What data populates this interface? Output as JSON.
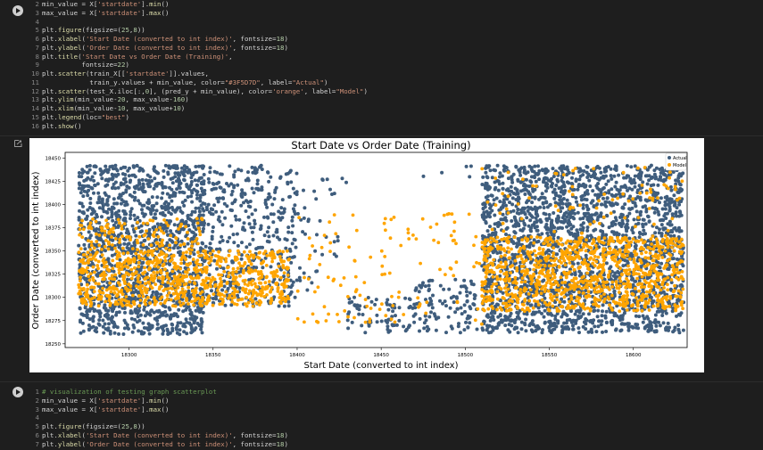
{
  "cell1": {
    "lines": [
      {
        "n": "2",
        "html": "min_value = X[<span class='str'>'startdate'</span>].<span class='fn'>min</span>()"
      },
      {
        "n": "3",
        "html": "max_value = X[<span class='str'>'startdate'</span>].<span class='fn'>max</span>()"
      },
      {
        "n": "4",
        "html": ""
      },
      {
        "n": "5",
        "html": "plt.<span class='fn'>figure</span>(figsize=(<span class='num'>25</span>,<span class='num'>8</span>))"
      },
      {
        "n": "6",
        "html": "plt.<span class='fn'>xlabel</span>(<span class='str'>'Start Date (converted to int index)'</span>, fontsize=<span class='num'>18</span>)"
      },
      {
        "n": "7",
        "html": "plt.<span class='fn'>ylabel</span>(<span class='str'>'Order Date (converted to int index)'</span>, fontsize=<span class='num'>18</span>)"
      },
      {
        "n": "8",
        "html": "plt.<span class='fn'>title</span>(<span class='str'>'Start Date vs Order Date (Training)'</span>,"
      },
      {
        "n": "9",
        "html": "          fontsize=<span class='num'>22</span>)"
      },
      {
        "n": "10",
        "html": "plt.<span class='fn'>scatter</span>(train_X[[<span class='str'>'startdate'</span>]].values,"
      },
      {
        "n": "11",
        "html": "            train_y.values + min_value, color=<span class='str'>\"#3F5D7D\"</span>, label=<span class='str'>\"Actual\"</span>)"
      },
      {
        "n": "12",
        "html": "plt.<span class='fn'>scatter</span>(test_X.iloc[:,<span class='num'>0</span>], (pred_y + min_value), color=<span class='str'>'orange'</span>, label=<span class='str'>\"Model\"</span>)"
      },
      {
        "n": "13",
        "html": "plt.<span class='fn'>ylim</span>(min_value-<span class='num'>20</span>, max_value-<span class='num'>160</span>)"
      },
      {
        "n": "14",
        "html": "plt.<span class='fn'>xlim</span>(min_value-<span class='num'>10</span>, max_value+<span class='num'>10</span>)"
      },
      {
        "n": "15",
        "html": "plt.<span class='fn'>legend</span>(loc=<span class='str'>\"best\"</span>)"
      },
      {
        "n": "16",
        "html": "plt.<span class='fn'>show</span>()"
      }
    ]
  },
  "cell2": {
    "lines": [
      {
        "n": "1",
        "html": "<span class='cmt'># visualization of testing graph scatterplot</span>"
      },
      {
        "n": "2",
        "html": "min_value = X[<span class='str'>'startdate'</span>].<span class='fn'>min</span>()"
      },
      {
        "n": "3",
        "html": "max_value = X[<span class='str'>'startdate'</span>].<span class='fn'>max</span>()"
      },
      {
        "n": "4",
        "html": ""
      },
      {
        "n": "5",
        "html": "plt.<span class='fn'>figure</span>(figsize=(<span class='num'>25</span>,<span class='num'>8</span>))"
      },
      {
        "n": "6",
        "html": "plt.<span class='fn'>xlabel</span>(<span class='str'>'Start Date (converted to int index)'</span>, fontsize=<span class='num'>18</span>)"
      },
      {
        "n": "7",
        "html": "plt.<span class='fn'>ylabel</span>(<span class='str'>'Order Date (converted to int index)'</span>, fontsize=<span class='num'>18</span>)"
      }
    ]
  },
  "chart_data": {
    "type": "scatter",
    "title": "Start Date vs Order Date (Training)",
    "xlabel": "Start Date (converted to int index)",
    "ylabel": "Order Date (converted to int index)",
    "xlim": [
      18262,
      18632
    ],
    "ylim": [
      18246,
      18456
    ],
    "xticks": [
      18300,
      18350,
      18400,
      18450,
      18500,
      18550,
      18600
    ],
    "yticks": [
      18250,
      18275,
      18300,
      18325,
      18350,
      18375,
      18400,
      18425,
      18450
    ],
    "legend": {
      "placement": "top-right",
      "entries": [
        {
          "name": "Actual",
          "color": "#3F5D7D"
        },
        {
          "name": "Model",
          "color": "#FFA500"
        }
      ]
    },
    "series": [
      {
        "name": "Actual",
        "color": "#3F5D7D",
        "regions": [
          {
            "x": [
              18270,
              18300
            ],
            "y": [
              18260,
              18442
            ],
            "density": "dense"
          },
          {
            "x": [
              18300,
              18345
            ],
            "y": [
              18260,
              18442
            ],
            "density": "dense"
          },
          {
            "x": [
              18345,
              18400
            ],
            "y": [
              18290,
              18442
            ],
            "density": "medium"
          },
          {
            "x": [
              18400,
              18430
            ],
            "y": [
              18300,
              18442
            ],
            "density": "sparse"
          },
          {
            "x": [
              18430,
              18470
            ],
            "y": [
              18262,
              18300
            ],
            "density": "medium"
          },
          {
            "x": [
              18470,
              18507
            ],
            "y": [
              18262,
              18320
            ],
            "density": "medium"
          },
          {
            "x": [
              18475,
              18505
            ],
            "y": [
              18425,
              18442
            ],
            "density": "sparse"
          },
          {
            "x": [
              18510,
              18630
            ],
            "y": [
              18262,
              18442
            ],
            "density": "dense"
          }
        ]
      },
      {
        "name": "Model",
        "color": "#FFA500",
        "regions": [
          {
            "x": [
              18270,
              18395
            ],
            "y": [
              18290,
              18350
            ],
            "density": "dense"
          },
          {
            "x": [
              18270,
              18345
            ],
            "y": [
              18350,
              18385
            ],
            "density": "medium"
          },
          {
            "x": [
              18395,
              18510
            ],
            "y": [
              18270,
              18390
            ],
            "density": "sparse"
          },
          {
            "x": [
              18510,
              18630
            ],
            "y": [
              18285,
              18365
            ],
            "density": "dense"
          },
          {
            "x": [
              18510,
              18630
            ],
            "y": [
              18365,
              18440
            ],
            "density": "sparse"
          }
        ]
      }
    ]
  }
}
